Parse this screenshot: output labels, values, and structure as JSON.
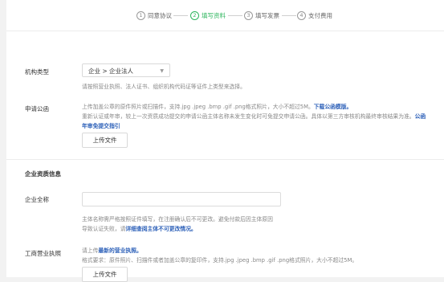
{
  "steps": [
    {
      "num": "1",
      "label": "同意协议"
    },
    {
      "num": "2",
      "label": "填写资料"
    },
    {
      "num": "3",
      "label": "填写发票"
    },
    {
      "num": "4",
      "label": "支付费用"
    }
  ],
  "org_type": {
    "label": "机构类型",
    "selected": "企业 > 企业法人",
    "hint": "请按照营业执照、法人证书、组织机构代码证等证件上类型来选择。"
  },
  "letter": {
    "label": "申请公函",
    "hint1": "上传加盖公章的原件照片或扫描件，支持.jpg .jpeg .bmp .gif .png格式照片，大小不超过5M。",
    "hint1_link": "下载公函模版。",
    "hint2": "重新认证或年审，较上一次资质成功提交的申请公函主体名称未发生变化时可免提交申请公函。具体以第三方审核机构最终审核结果为准。",
    "hint2_link": "公函",
    "hint3_link": "年审免提交指引",
    "upload": "上传文件"
  },
  "company": {
    "section_title": "企业资质信息",
    "name_label": "企业全称",
    "name_value": "",
    "hint1": "主体名称需严格按照证件填写，在注册确认后不可更改。避免付款后因主体原因",
    "hint2": "导致认证失败，请",
    "hint2_link": "详细查阅主体不可更改情况。"
  },
  "license": {
    "label": "工商营业执照",
    "hint1_pre": "请上传",
    "hint1_link": "最新的营业执照。",
    "hint2": "格式要求：原件照片、扫描件或者加盖公章的复印件，支持.jpg .jpeg .bmp .gif .png格式照片，大小不超过5M。",
    "upload": "上传文件"
  }
}
